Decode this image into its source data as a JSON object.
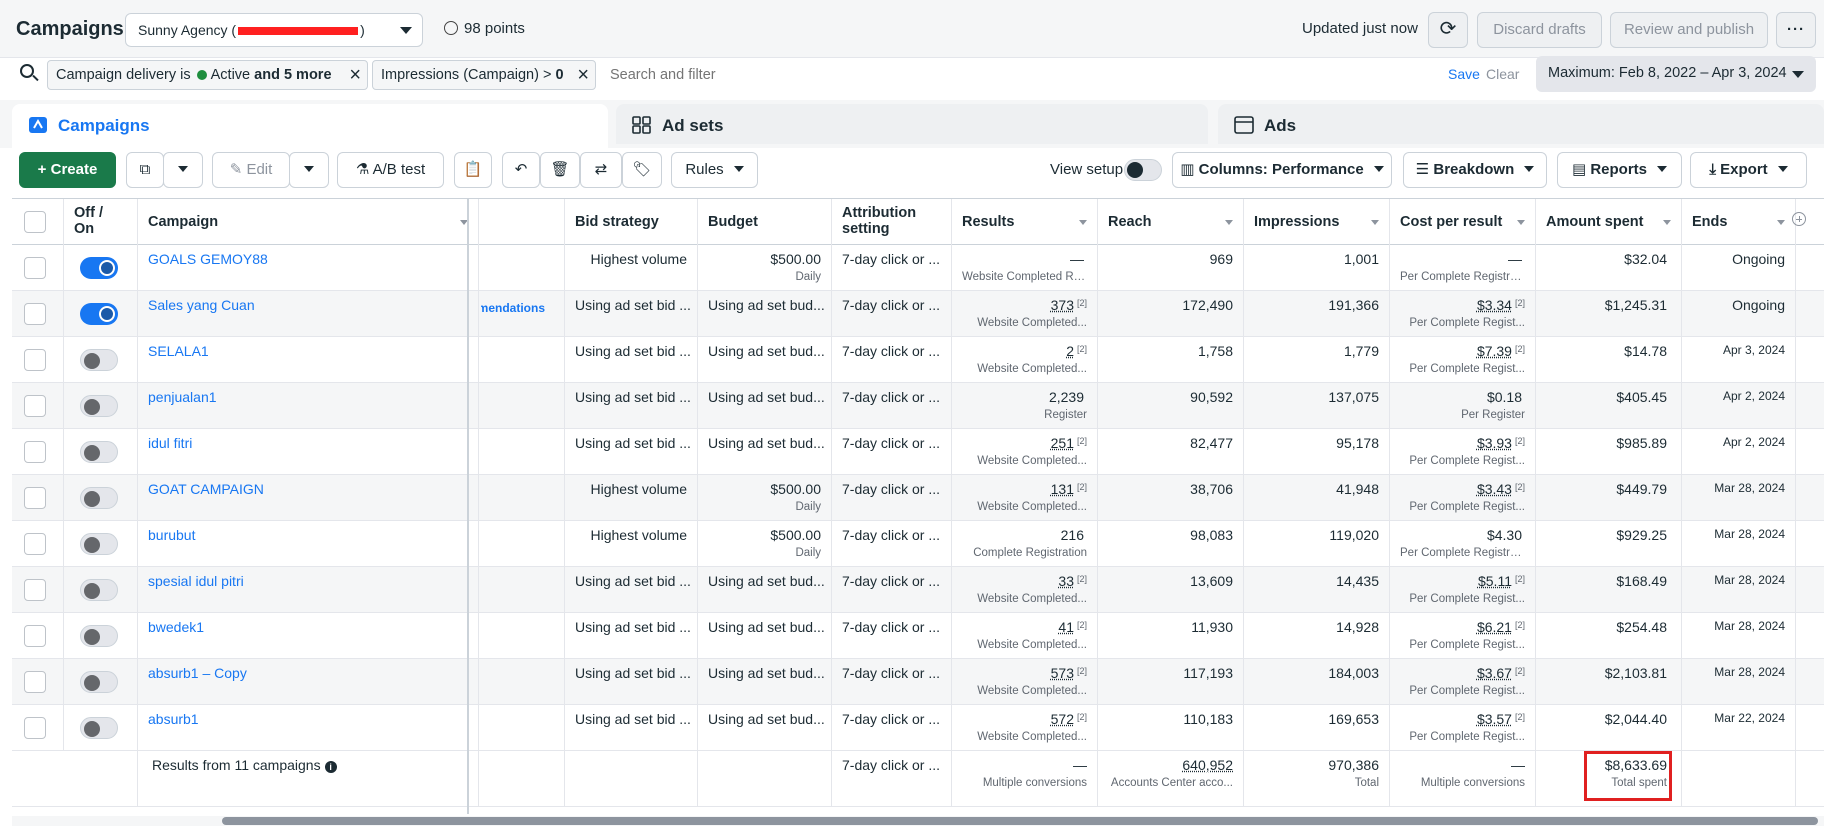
{
  "header": {
    "title": "Campaigns",
    "account_prefix": "Sunny Agency (",
    "account_suffix": ")",
    "points": "98 points",
    "updated": "Updated just now",
    "discard": "Discard drafts",
    "review": "Review and publish",
    "more": "···"
  },
  "filters": {
    "chip1_prefix": "Campaign delivery is",
    "chip1_value": "Active",
    "chip1_more": "and 5 more",
    "chip2_text": "Impressions (Campaign) >",
    "chip2_value": "0",
    "search_placeholder": "Search and filter",
    "save": "Save",
    "clear": "Clear",
    "date_range": "Maximum: Feb 8, 2022 – Apr 3, 2024"
  },
  "tabs": {
    "campaigns": "Campaigns",
    "adsets": "Ad sets",
    "ads": "Ads"
  },
  "toolbar": {
    "create": "Create",
    "edit": "Edit",
    "ab_test": "A/B test",
    "rules": "Rules",
    "view_setup": "View setup",
    "columns": "Columns: Performance",
    "breakdown": "Breakdown",
    "reports": "Reports",
    "export": "Export"
  },
  "table": {
    "headers": {
      "off_on": "Off / On",
      "campaign": "Campaign",
      "bid_strategy": "Bid strategy",
      "budget": "Budget",
      "attribution": "Attribution setting",
      "results": "Results",
      "reach": "Reach",
      "impressions": "Impressions",
      "cost_per_result": "Cost per result",
      "amount_spent": "Amount spent",
      "ends": "Ends"
    },
    "recommendations_fragment": "mmendations",
    "rows": [
      {
        "name": "GOALS GEMOY88",
        "on": true,
        "bid": "Highest volume",
        "budget": "$500.00",
        "budget_sub": "Daily",
        "attr": "7-day click or ...",
        "results": "—",
        "results_sup": "",
        "results_sub": "Website Completed Re...",
        "reach": "969",
        "impr": "1,001",
        "cpr": "—",
        "cpr_sup": "",
        "cpr_sub": "Per Complete Registra...",
        "spent": "$32.04",
        "ends": "Ongoing"
      },
      {
        "name": "Sales yang Cuan",
        "on": true,
        "bid": "Using ad set bid ...",
        "budget": "Using ad set bud...",
        "budget_sub": "",
        "attr": "7-day click or ...",
        "results": "373",
        "results_sup": "[2]",
        "results_sub": "Website Completed...",
        "reach": "172,490",
        "impr": "191,366",
        "cpr": "$3.34",
        "cpr_sup": "[2]",
        "cpr_sub": "Per Complete Regist...",
        "spent": "$1,245.31",
        "ends": "Ongoing"
      },
      {
        "name": "SELALA1",
        "on": false,
        "bid": "Using ad set bid ...",
        "budget": "Using ad set bud...",
        "budget_sub": "",
        "attr": "7-day click or ...",
        "results": "2",
        "results_sup": "[2]",
        "results_sub": "Website Completed...",
        "reach": "1,758",
        "impr": "1,779",
        "cpr": "$7.39",
        "cpr_sup": "[2]",
        "cpr_sub": "Per Complete Regist...",
        "spent": "$14.78",
        "ends": "Apr 3, 2024"
      },
      {
        "name": "penjualan1",
        "on": false,
        "bid": "Using ad set bid ...",
        "budget": "Using ad set bud...",
        "budget_sub": "",
        "attr": "7-day click or ...",
        "results": "2,239",
        "results_sup": "",
        "results_sub": "Register",
        "reach": "90,592",
        "impr": "137,075",
        "cpr": "$0.18",
        "cpr_sup": "",
        "cpr_sub": "Per Register",
        "spent": "$405.45",
        "ends": "Apr 2, 2024"
      },
      {
        "name": "idul fitri",
        "on": false,
        "bid": "Using ad set bid ...",
        "budget": "Using ad set bud...",
        "budget_sub": "",
        "attr": "7-day click or ...",
        "results": "251",
        "results_sup": "[2]",
        "results_sub": "Website Completed...",
        "reach": "82,477",
        "impr": "95,178",
        "cpr": "$3.93",
        "cpr_sup": "[2]",
        "cpr_sub": "Per Complete Regist...",
        "spent": "$985.89",
        "ends": "Apr 2, 2024"
      },
      {
        "name": "GOAT CAMPAIGN",
        "on": false,
        "bid": "Highest volume",
        "budget": "$500.00",
        "budget_sub": "Daily",
        "attr": "7-day click or ...",
        "results": "131",
        "results_sup": "[2]",
        "results_sub": "Website Completed...",
        "reach": "38,706",
        "impr": "41,948",
        "cpr": "$3.43",
        "cpr_sup": "[2]",
        "cpr_sub": "Per Complete Regist...",
        "spent": "$449.79",
        "ends": "Mar 28, 2024"
      },
      {
        "name": "burubut",
        "on": false,
        "bid": "Highest volume",
        "budget": "$500.00",
        "budget_sub": "Daily",
        "attr": "7-day click or ...",
        "results": "216",
        "results_sup": "",
        "results_sub": "Complete Registration",
        "reach": "98,083",
        "impr": "119,020",
        "cpr": "$4.30",
        "cpr_sup": "",
        "cpr_sub": "Per Complete Registra...",
        "spent": "$929.25",
        "ends": "Mar 28, 2024"
      },
      {
        "name": "spesial idul pitri",
        "on": false,
        "bid": "Using ad set bid ...",
        "budget": "Using ad set bud...",
        "budget_sub": "",
        "attr": "7-day click or ...",
        "results": "33",
        "results_sup": "[2]",
        "results_sub": "Website Completed...",
        "reach": "13,609",
        "impr": "14,435",
        "cpr": "$5.11",
        "cpr_sup": "[2]",
        "cpr_sub": "Per Complete Regist...",
        "spent": "$168.49",
        "ends": "Mar 28, 2024"
      },
      {
        "name": "bwedek1",
        "on": false,
        "bid": "Using ad set bid ...",
        "budget": "Using ad set bud...",
        "budget_sub": "",
        "attr": "7-day click or ...",
        "results": "41",
        "results_sup": "[2]",
        "results_sub": "Website Completed...",
        "reach": "11,930",
        "impr": "14,928",
        "cpr": "$6.21",
        "cpr_sup": "[2]",
        "cpr_sub": "Per Complete Regist...",
        "spent": "$254.48",
        "ends": "Mar 28, 2024"
      },
      {
        "name": "absurb1 – Copy",
        "on": false,
        "bid": "Using ad set bid ...",
        "budget": "Using ad set bud...",
        "budget_sub": "",
        "attr": "7-day click or ...",
        "results": "573",
        "results_sup": "[2]",
        "results_sub": "Website Completed...",
        "reach": "117,193",
        "impr": "184,003",
        "cpr": "$3.67",
        "cpr_sup": "[2]",
        "cpr_sub": "Per Complete Regist...",
        "spent": "$2,103.81",
        "ends": "Mar 28, 2024"
      },
      {
        "name": "absurb1",
        "on": false,
        "bid": "Using ad set bid ...",
        "budget": "Using ad set bud...",
        "budget_sub": "",
        "attr": "7-day click or ...",
        "results": "572",
        "results_sup": "[2]",
        "results_sub": "Website Completed...",
        "reach": "110,183",
        "impr": "169,653",
        "cpr": "$3.57",
        "cpr_sup": "[2]",
        "cpr_sub": "Per Complete Regist...",
        "spent": "$2,044.40",
        "ends": "Mar 22, 2024"
      }
    ],
    "totals": {
      "label": "Results from 11 campaigns",
      "attr": "7-day click or ...",
      "results": "—",
      "results_sub": "Multiple conversions",
      "reach": "640,952",
      "reach_sub": "Accounts Center acco...",
      "impr": "970,386",
      "impr_sub": "Total",
      "cpr": "—",
      "cpr_sub": "Multiple conversions",
      "spent": "$8,633.69",
      "spent_sub": "Total spent"
    }
  },
  "colors": {
    "accent": "#1877f2",
    "create_green": "#1a7a4a",
    "highlight_red": "#e02020"
  }
}
